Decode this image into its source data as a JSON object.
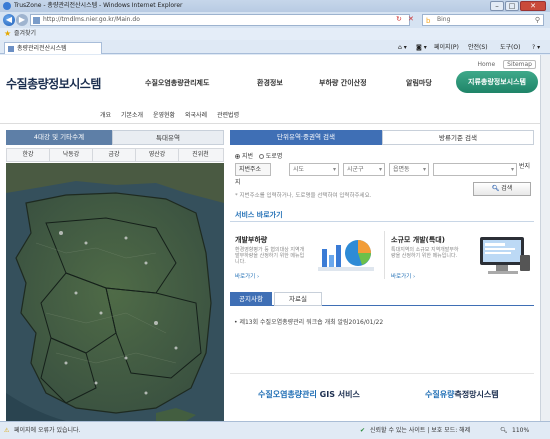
{
  "window": {
    "title": "TrusZone - 총량관리전산시스템 - Windows Internet Explorer",
    "url": "http://tmdlms.nier.go.kr/Main.do",
    "search_placeholder": "Bing",
    "favorites_label": "즐겨찾기",
    "tab_label": "총량관리전산시스템",
    "tools": [
      "페이지(P)",
      "안전(S)",
      "도구(O)"
    ]
  },
  "header": {
    "home_link": "Home",
    "sitemap_link": "Sitemap",
    "logo": "수질총량정보시스템",
    "gnb": [
      "수질오염총량관리제도",
      "환경정보",
      "부하량 간이산정",
      "알림마당"
    ],
    "green_button": "지류총량정보시스템",
    "subnav": [
      "개요",
      "기본소개",
      "운영현황",
      "외국사례",
      "관련법령"
    ]
  },
  "map_panel": {
    "tabs": [
      "4대강 및 기타수계",
      "특대유역"
    ],
    "rivers": [
      "한강",
      "낙동강",
      "금강",
      "영산강",
      "진위천"
    ]
  },
  "search_panel": {
    "tabs": [
      "단위유역·중권역 검색",
      "방류기준 검색"
    ],
    "radio_options": [
      "지번",
      "도로명"
    ],
    "address_label": "지번주소",
    "select_sido": "시도",
    "select_sigungu": "시군구",
    "select_eupmyeondong": "읍면동",
    "bunji_label": "번지",
    "jibun_label": "지",
    "search_button": "검색",
    "help_text": "* 지번주소를 입력하거나, 도로명을 선택하여 입력하주세요."
  },
  "services": {
    "title": "서비스 바로가기",
    "items": [
      {
        "title": "개발부하량",
        "desc": "환경영향평가 등 협의대상 지역개발부하량을 산정하기 위한 메뉴입니다.",
        "more": "바로가기 ›"
      },
      {
        "title": "소규모 개발(특대)",
        "desc": "특대지역의 소규모 지역개발부하량을 산정하기 위한 메뉴입니다.",
        "more": "바로가기 ›"
      }
    ]
  },
  "notice": {
    "tabs": [
      "공지사항",
      "자료실"
    ],
    "items": [
      "제13회 수질오염총량관리 워크숍 개최 알림2016/01/22"
    ]
  },
  "bottom_links": [
    {
      "accent": "수질오염총량관리",
      "rest": " GIS 서비스"
    },
    {
      "accent": "수질유량",
      "rest": "측정망시스템"
    }
  ],
  "status": {
    "left": "페이지에 오류가 있습니다.",
    "zone": "신뢰할 수 있는 사이트 | 보호 모드: 해제",
    "zoom": "110%"
  },
  "colors": {
    "brand_navy": "#1b2e4f",
    "accent_blue": "#3f6fb5",
    "green_button": "#2b9a7a"
  }
}
